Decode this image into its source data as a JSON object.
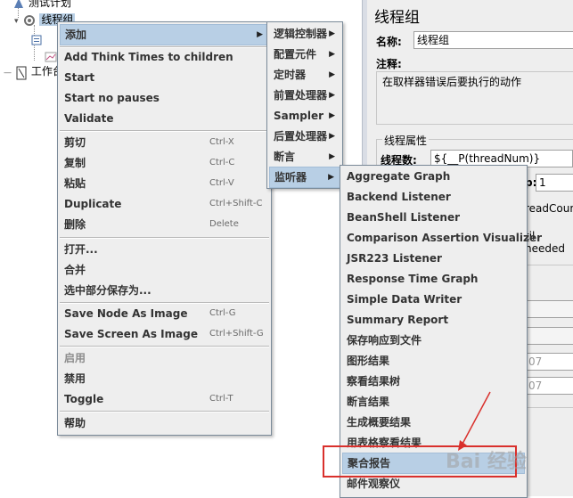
{
  "tree": {
    "items": [
      {
        "label": "测试计划"
      },
      {
        "label": "线程组"
      },
      {
        "label": "工作台"
      }
    ]
  },
  "right_panel": {
    "title": "线程组",
    "name_label": "名称:",
    "name_value": "线程组",
    "comment_label": "注释:",
    "on_error_title": "在取样器错误后要执行的动作",
    "thread_props_title": "线程属性",
    "thread_count_label": "线程数:",
    "thread_count_value": "${__P(threadNum)}",
    "ramp_label_partial": "p:",
    "ramp_value": "1",
    "loop_partial": "readCoun",
    "until_partial": "til needed",
    "date1_partial": "07",
    "date2_partial": "07"
  },
  "context_menu": {
    "items": [
      {
        "label": "添加",
        "shortcut": "",
        "submenu": true,
        "highlighted": true,
        "disabled": false
      },
      {
        "label": "Add Think Times to children",
        "shortcut": ""
      },
      {
        "label": "Start",
        "shortcut": ""
      },
      {
        "label": "Start no pauses",
        "shortcut": ""
      },
      {
        "label": "Validate",
        "shortcut": ""
      },
      {
        "label": "剪切",
        "shortcut": "Ctrl-X"
      },
      {
        "label": "复制",
        "shortcut": "Ctrl-C"
      },
      {
        "label": "粘贴",
        "shortcut": "Ctrl-V"
      },
      {
        "label": "Duplicate",
        "shortcut": "Ctrl+Shift-C"
      },
      {
        "label": "删除",
        "shortcut": "Delete"
      },
      {
        "label": "打开...",
        "shortcut": ""
      },
      {
        "label": "合并",
        "shortcut": ""
      },
      {
        "label": "选中部分保存为...",
        "shortcut": ""
      },
      {
        "label": "Save Node As Image",
        "shortcut": "Ctrl-G"
      },
      {
        "label": "Save Screen As Image",
        "shortcut": "Ctrl+Shift-G"
      },
      {
        "label": "启用",
        "shortcut": "",
        "disabled": true
      },
      {
        "label": "禁用",
        "shortcut": ""
      },
      {
        "label": "Toggle",
        "shortcut": "Ctrl-T"
      },
      {
        "label": "帮助",
        "shortcut": ""
      }
    ]
  },
  "add_submenu": {
    "items": [
      {
        "label": "逻辑控制器"
      },
      {
        "label": "配置元件"
      },
      {
        "label": "定时器"
      },
      {
        "label": "前置处理器"
      },
      {
        "label": "Sampler"
      },
      {
        "label": "后置处理器"
      },
      {
        "label": "断言"
      },
      {
        "label": "监听器"
      }
    ]
  },
  "listener_submenu": {
    "items": [
      {
        "label": "Aggregate Graph"
      },
      {
        "label": "Backend Listener"
      },
      {
        "label": "BeanShell Listener"
      },
      {
        "label": "Comparison Assertion Visualizer"
      },
      {
        "label": "JSR223 Listener"
      },
      {
        "label": "Response Time Graph"
      },
      {
        "label": "Simple Data Writer"
      },
      {
        "label": "Summary Report"
      },
      {
        "label": "保存响应到文件"
      },
      {
        "label": "图形结果"
      },
      {
        "label": "察看结果树"
      },
      {
        "label": "断言结果"
      },
      {
        "label": "生成概要结果"
      },
      {
        "label": "用表格察看结果"
      },
      {
        "label": "聚合报告"
      },
      {
        "label": "邮件观察仪"
      }
    ]
  },
  "watermark": {
    "text": "Bai 经验"
  },
  "colors": {
    "highlight": "#b8cfe5",
    "annotation": "#d9302c"
  }
}
